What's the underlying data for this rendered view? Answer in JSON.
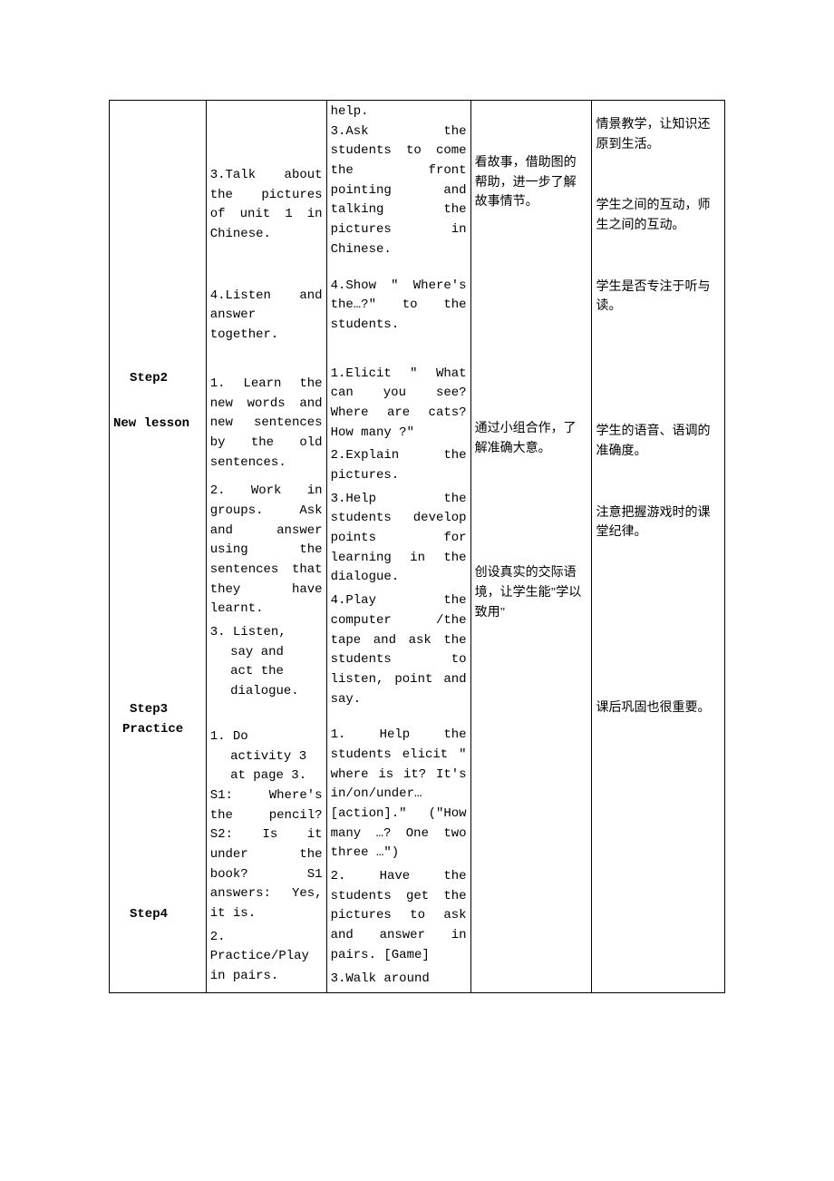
{
  "col1": {
    "step2": "Step2",
    "newlesson": "New lesson",
    "step3": "Step3",
    "practice": "Practice",
    "step4": "Step4"
  },
  "col2": {
    "p1": "3.Talk about the pictures of unit 1 in Chinese.",
    "p2": "4.Listen and answer together.",
    "p3": "1. Learn the new words and new sentences by the old sentences.",
    "p4": "2. Work in groups. Ask and answer using the sentences that they have learnt.",
    "p5a": "3. Listen,",
    "p5b": "say and",
    "p5c": "act the",
    "p5d": "dialogue.",
    "p6a": "1. Do",
    "p6b": "activity 3",
    "p6c": "at page 3.",
    "p7": "S1: Where's the pencil? S2: Is it under the book? S1 answers: Yes, it is.",
    "p8": "2. Practice/Play in pairs."
  },
  "col3": {
    "p0": "help.",
    "p1": "3.Ask the students to come the front pointing and talking the pictures in Chinese.",
    "p2": "4.Show \" Where's the…?\" to the students.",
    "p3": "1.Elicit \" What can you see? Where are cats? How many ?\"",
    "p4": "2.Explain the pictures.",
    "p5": "3.Help the students develop points for learning in the dialogue.",
    "p6": "4.Play the computer /the tape and ask the students to listen, point and say.",
    "p7": "1. Help the students elicit \" where is it? It's in/on/under… [action].\" (\"How many …? One two three …\")",
    "p8": "2. Have the students get the pictures to ask and answer in pairs. [Game]",
    "p9": "3.Walk around"
  },
  "col4": {
    "p1": "看故事，借助图的帮助，进一步了解故事情节。",
    "p2": "通过小组合作，了解准确大意。",
    "p3": "创设真实的交际语境，让学生能\"学以致用\""
  },
  "col5": {
    "p1": "情景教学，让知识还原到生活。",
    "p2": "学生之间的互动，师生之间的互动。",
    "p3": "学生是否专注于听与读。",
    "p4": "学生的语音、语调的准确度。",
    "p5": "注意把握游戏时的课堂纪律。",
    "p6": "课后巩固也很重要。"
  }
}
